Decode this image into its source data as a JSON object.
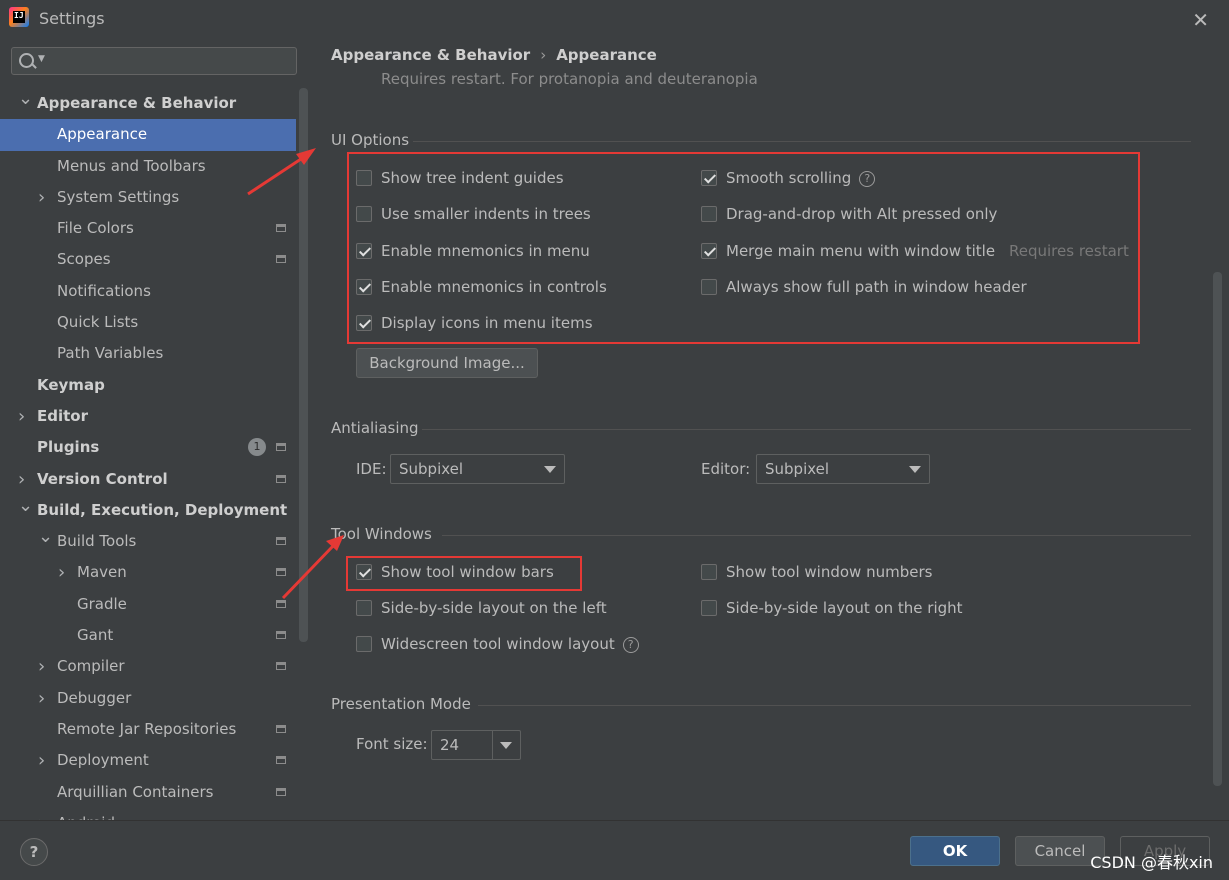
{
  "window": {
    "title": "Settings",
    "logo_text": "IJ"
  },
  "search": {
    "placeholder": ""
  },
  "sidebar": {
    "items": [
      {
        "label": "Appearance & Behavior",
        "level": 0,
        "expanded": true,
        "bold": true
      },
      {
        "label": "Appearance",
        "level": 1,
        "selected": true
      },
      {
        "label": "Menus and Toolbars",
        "level": 1
      },
      {
        "label": "System Settings",
        "level": 1,
        "collapsed": true
      },
      {
        "label": "File Colors",
        "level": 1,
        "page_icon": true
      },
      {
        "label": "Scopes",
        "level": 1,
        "page_icon": true
      },
      {
        "label": "Notifications",
        "level": 1
      },
      {
        "label": "Quick Lists",
        "level": 1
      },
      {
        "label": "Path Variables",
        "level": 1
      },
      {
        "label": "Keymap",
        "level": 0,
        "bold": true
      },
      {
        "label": "Editor",
        "level": 0,
        "bold": true,
        "collapsed": true
      },
      {
        "label": "Plugins",
        "level": 0,
        "bold": true,
        "badge": "1",
        "page_icon": true
      },
      {
        "label": "Version Control",
        "level": 0,
        "bold": true,
        "collapsed": true,
        "page_icon": true
      },
      {
        "label": "Build, Execution, Deployment",
        "level": 0,
        "bold": true,
        "expanded": true
      },
      {
        "label": "Build Tools",
        "level": 1,
        "expanded": true,
        "page_icon": true
      },
      {
        "label": "Maven",
        "level": 2,
        "collapsed": true,
        "page_icon": true
      },
      {
        "label": "Gradle",
        "level": 2,
        "page_icon": true
      },
      {
        "label": "Gant",
        "level": 2,
        "page_icon": true
      },
      {
        "label": "Compiler",
        "level": 1,
        "collapsed": true,
        "page_icon": true
      },
      {
        "label": "Debugger",
        "level": 1,
        "collapsed": true
      },
      {
        "label": "Remote Jar Repositories",
        "level": 1,
        "page_icon": true
      },
      {
        "label": "Deployment",
        "level": 1,
        "collapsed": true,
        "page_icon": true
      },
      {
        "label": "Arquillian Containers",
        "level": 1,
        "page_icon": true
      },
      {
        "label": "Android",
        "level": 1,
        "collapsed": true
      }
    ]
  },
  "breadcrumb": {
    "parent": "Appearance & Behavior",
    "separator": "›",
    "current": "Appearance"
  },
  "restart_note": "Requires restart. For protanopia and deuteranopia",
  "ui_options": {
    "title": "UI Options",
    "left": [
      {
        "label": "Show tree indent guides",
        "checked": false
      },
      {
        "label": "Use smaller indents in trees",
        "checked": false
      },
      {
        "label": "Enable mnemonics in menu",
        "checked": true
      },
      {
        "label": "Enable mnemonics in controls",
        "checked": true
      },
      {
        "label": "Display icons in menu items",
        "checked": true
      }
    ],
    "right": [
      {
        "label": "Smooth scrolling",
        "checked": true,
        "help": "?"
      },
      {
        "label": "Drag-and-drop with Alt pressed only",
        "checked": false
      },
      {
        "label": "Merge main menu with window title",
        "checked": true,
        "hint": "Requires restart"
      },
      {
        "label": "Always show full path in window header",
        "checked": false
      }
    ],
    "background_button": "Background Image..."
  },
  "antialiasing": {
    "title": "Antialiasing",
    "ide_label": "IDE:",
    "ide_value": "Subpixel",
    "editor_label": "Editor:",
    "editor_value": "Subpixel"
  },
  "tool_windows": {
    "title": "Tool Windows",
    "left": [
      {
        "label": "Show tool window bars",
        "checked": true
      },
      {
        "label": "Side-by-side layout on the left",
        "checked": false
      },
      {
        "label": "Widescreen tool window layout",
        "checked": false,
        "help": "?"
      }
    ],
    "right": [
      {
        "label": "Show tool window numbers",
        "checked": false
      },
      {
        "label": "Side-by-side layout on the right",
        "checked": false
      }
    ]
  },
  "presentation": {
    "title": "Presentation Mode",
    "font_label": "Font size:",
    "font_value": "24"
  },
  "footer": {
    "help": "?",
    "ok": "OK",
    "cancel": "Cancel",
    "apply": "Apply"
  },
  "watermark": "CSDN @春秋xin",
  "colors": {
    "selection": "#4b6eaf",
    "annotation": "#e53935",
    "ok_button": "#365880",
    "background": "#3c3f41"
  }
}
